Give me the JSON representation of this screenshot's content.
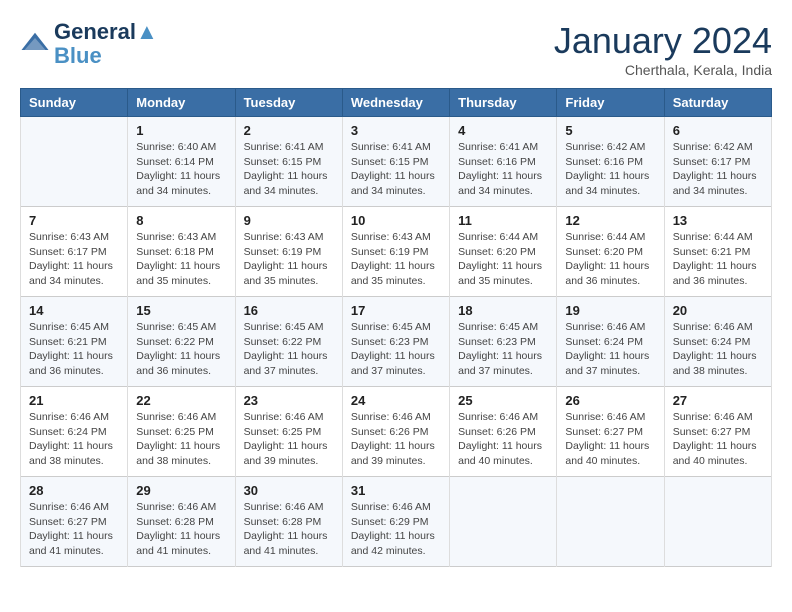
{
  "logo": {
    "line1": "General",
    "line2": "Blue"
  },
  "title": "January 2024",
  "subtitle": "Cherthala, Kerala, India",
  "headers": [
    "Sunday",
    "Monday",
    "Tuesday",
    "Wednesday",
    "Thursday",
    "Friday",
    "Saturday"
  ],
  "weeks": [
    [
      {
        "day": "",
        "info": ""
      },
      {
        "day": "1",
        "info": "Sunrise: 6:40 AM\nSunset: 6:14 PM\nDaylight: 11 hours\nand 34 minutes."
      },
      {
        "day": "2",
        "info": "Sunrise: 6:41 AM\nSunset: 6:15 PM\nDaylight: 11 hours\nand 34 minutes."
      },
      {
        "day": "3",
        "info": "Sunrise: 6:41 AM\nSunset: 6:15 PM\nDaylight: 11 hours\nand 34 minutes."
      },
      {
        "day": "4",
        "info": "Sunrise: 6:41 AM\nSunset: 6:16 PM\nDaylight: 11 hours\nand 34 minutes."
      },
      {
        "day": "5",
        "info": "Sunrise: 6:42 AM\nSunset: 6:16 PM\nDaylight: 11 hours\nand 34 minutes."
      },
      {
        "day": "6",
        "info": "Sunrise: 6:42 AM\nSunset: 6:17 PM\nDaylight: 11 hours\nand 34 minutes."
      }
    ],
    [
      {
        "day": "7",
        "info": "Sunrise: 6:43 AM\nSunset: 6:17 PM\nDaylight: 11 hours\nand 34 minutes."
      },
      {
        "day": "8",
        "info": "Sunrise: 6:43 AM\nSunset: 6:18 PM\nDaylight: 11 hours\nand 35 minutes."
      },
      {
        "day": "9",
        "info": "Sunrise: 6:43 AM\nSunset: 6:19 PM\nDaylight: 11 hours\nand 35 minutes."
      },
      {
        "day": "10",
        "info": "Sunrise: 6:43 AM\nSunset: 6:19 PM\nDaylight: 11 hours\nand 35 minutes."
      },
      {
        "day": "11",
        "info": "Sunrise: 6:44 AM\nSunset: 6:20 PM\nDaylight: 11 hours\nand 35 minutes."
      },
      {
        "day": "12",
        "info": "Sunrise: 6:44 AM\nSunset: 6:20 PM\nDaylight: 11 hours\nand 36 minutes."
      },
      {
        "day": "13",
        "info": "Sunrise: 6:44 AM\nSunset: 6:21 PM\nDaylight: 11 hours\nand 36 minutes."
      }
    ],
    [
      {
        "day": "14",
        "info": "Sunrise: 6:45 AM\nSunset: 6:21 PM\nDaylight: 11 hours\nand 36 minutes."
      },
      {
        "day": "15",
        "info": "Sunrise: 6:45 AM\nSunset: 6:22 PM\nDaylight: 11 hours\nand 36 minutes."
      },
      {
        "day": "16",
        "info": "Sunrise: 6:45 AM\nSunset: 6:22 PM\nDaylight: 11 hours\nand 37 minutes."
      },
      {
        "day": "17",
        "info": "Sunrise: 6:45 AM\nSunset: 6:23 PM\nDaylight: 11 hours\nand 37 minutes."
      },
      {
        "day": "18",
        "info": "Sunrise: 6:45 AM\nSunset: 6:23 PM\nDaylight: 11 hours\nand 37 minutes."
      },
      {
        "day": "19",
        "info": "Sunrise: 6:46 AM\nSunset: 6:24 PM\nDaylight: 11 hours\nand 37 minutes."
      },
      {
        "day": "20",
        "info": "Sunrise: 6:46 AM\nSunset: 6:24 PM\nDaylight: 11 hours\nand 38 minutes."
      }
    ],
    [
      {
        "day": "21",
        "info": "Sunrise: 6:46 AM\nSunset: 6:24 PM\nDaylight: 11 hours\nand 38 minutes."
      },
      {
        "day": "22",
        "info": "Sunrise: 6:46 AM\nSunset: 6:25 PM\nDaylight: 11 hours\nand 38 minutes."
      },
      {
        "day": "23",
        "info": "Sunrise: 6:46 AM\nSunset: 6:25 PM\nDaylight: 11 hours\nand 39 minutes."
      },
      {
        "day": "24",
        "info": "Sunrise: 6:46 AM\nSunset: 6:26 PM\nDaylight: 11 hours\nand 39 minutes."
      },
      {
        "day": "25",
        "info": "Sunrise: 6:46 AM\nSunset: 6:26 PM\nDaylight: 11 hours\nand 40 minutes."
      },
      {
        "day": "26",
        "info": "Sunrise: 6:46 AM\nSunset: 6:27 PM\nDaylight: 11 hours\nand 40 minutes."
      },
      {
        "day": "27",
        "info": "Sunrise: 6:46 AM\nSunset: 6:27 PM\nDaylight: 11 hours\nand 40 minutes."
      }
    ],
    [
      {
        "day": "28",
        "info": "Sunrise: 6:46 AM\nSunset: 6:27 PM\nDaylight: 11 hours\nand 41 minutes."
      },
      {
        "day": "29",
        "info": "Sunrise: 6:46 AM\nSunset: 6:28 PM\nDaylight: 11 hours\nand 41 minutes."
      },
      {
        "day": "30",
        "info": "Sunrise: 6:46 AM\nSunset: 6:28 PM\nDaylight: 11 hours\nand 41 minutes."
      },
      {
        "day": "31",
        "info": "Sunrise: 6:46 AM\nSunset: 6:29 PM\nDaylight: 11 hours\nand 42 minutes."
      },
      {
        "day": "",
        "info": ""
      },
      {
        "day": "",
        "info": ""
      },
      {
        "day": "",
        "info": ""
      }
    ]
  ]
}
